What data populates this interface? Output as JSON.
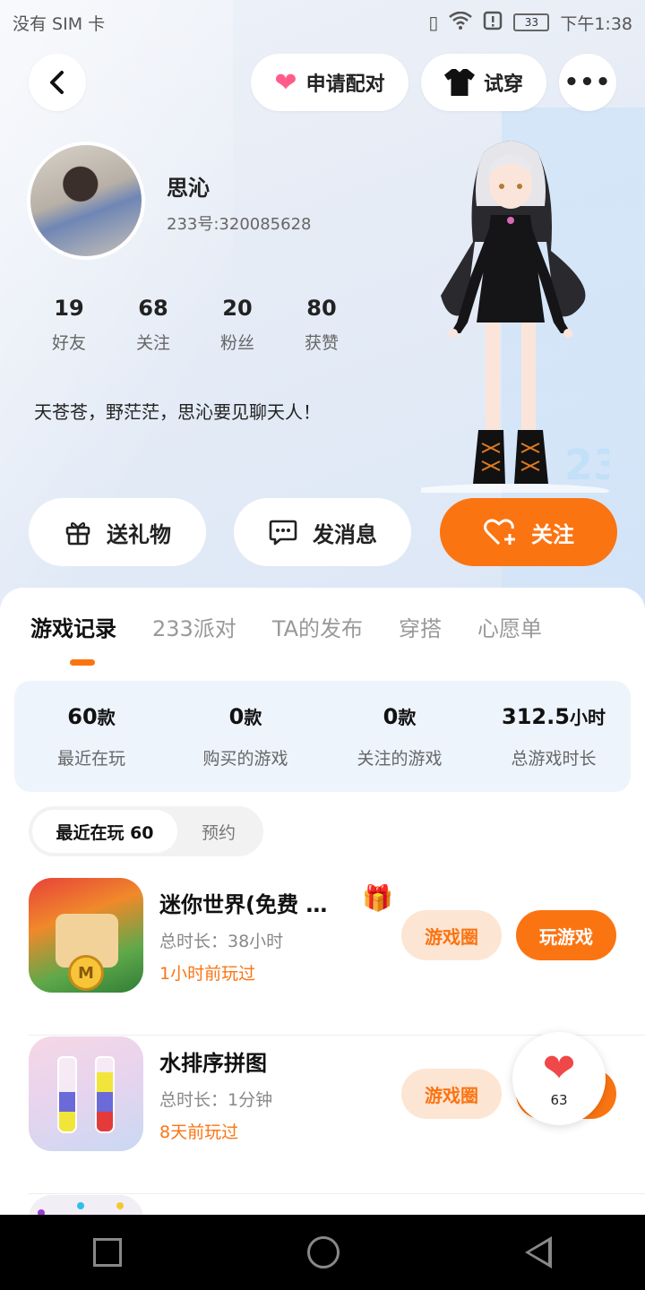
{
  "status_bar": {
    "carrier": "没有 SIM 卡",
    "time": "下午1:38",
    "battery": "33",
    "icons": [
      "vibrate-icon",
      "wifi-icon",
      "alert-icon",
      "battery-icon"
    ]
  },
  "topbar": {
    "pair_label": "申请配对",
    "try_on_label": "试穿",
    "more_label": "•••"
  },
  "profile": {
    "name": "思沁",
    "id": "233号:320085628",
    "stats": [
      {
        "value": "19",
        "label": "好友"
      },
      {
        "value": "68",
        "label": "关注"
      },
      {
        "value": "20",
        "label": "粉丝"
      },
      {
        "value": "80",
        "label": "获赞"
      }
    ],
    "bio": "天苍苍，野茫茫，思沁要见聊天人！"
  },
  "actions": {
    "gift_label": "送礼物",
    "message_label": "发消息",
    "follow_label": "关注"
  },
  "tabs": [
    {
      "label": "游戏记录",
      "active": true
    },
    {
      "label": "233派对",
      "active": false
    },
    {
      "label": "TA的发布",
      "active": false
    },
    {
      "label": "穿搭",
      "active": false
    },
    {
      "label": "心愿单",
      "active": false
    }
  ],
  "summary": [
    {
      "value": "60",
      "unit": "款",
      "label": "最近在玩"
    },
    {
      "value": "0",
      "unit": "款",
      "label": "购买的游戏"
    },
    {
      "value": "0",
      "unit": "款",
      "label": "关注的游戏"
    },
    {
      "value": "312.5",
      "unit": "小时",
      "label": "总游戏时长"
    }
  ],
  "segment": {
    "recent_label": "最近在玩 60",
    "reserve_label": "预约"
  },
  "games": [
    {
      "name": "迷你世界(免费 …",
      "duration": "总时长：38小时",
      "last_played": "1小时前玩过",
      "circle_label": "游戏圈",
      "play_label": "玩游戏",
      "icon_letter": "M"
    },
    {
      "name": "水排序拼图",
      "duration": "总时长：1分钟",
      "last_played": "8天前玩过",
      "circle_label": "游戏圈",
      "play_label": ""
    }
  ],
  "floating_like": {
    "count": "63"
  },
  "colors": {
    "accent": "#fb7412",
    "accent_light": "#fde5d3",
    "pink": "#ff5c8a",
    "summary_bg": "#eef4fc"
  }
}
